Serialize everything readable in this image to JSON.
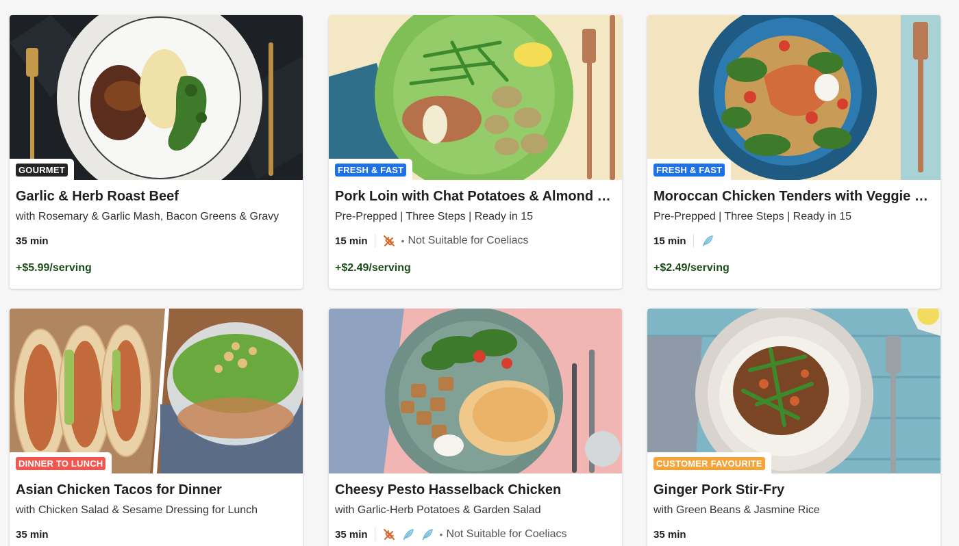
{
  "recipes": [
    {
      "tag": "GOURMET",
      "tag_color": "#242424",
      "title": "Garlic & Herb Roast Beef",
      "subtitle": "with Rosemary & Garlic Mash, Bacon Greens & Gravy",
      "time": "35 min",
      "note": "",
      "price": "+$5.99/serving"
    },
    {
      "tag": "FRESH & FAST",
      "tag_color": "#1e72e8",
      "title": "Pork Loin with Chat Potatoes & Almond Gre…",
      "subtitle": "Pre-Prepped | Three Steps | Ready in 15",
      "time": "15 min",
      "note": "Not Suitable for Coeliacs",
      "price": "+$2.49/serving"
    },
    {
      "tag": "FRESH & FAST",
      "tag_color": "#1e72e8",
      "title": "Moroccan Chicken Tenders with Veggie Cou…",
      "subtitle": "Pre-Prepped | Three Steps | Ready in 15",
      "time": "15 min",
      "note": "",
      "price": "+$2.49/serving"
    },
    {
      "tag": "DINNER TO LUNCH",
      "tag_color": "#f2564f",
      "title": "Asian Chicken Tacos for Dinner",
      "subtitle": "with Chicken Salad & Sesame Dressing for Lunch",
      "time": "35 min",
      "note": "",
      "price": ""
    },
    {
      "tag": "",
      "tag_color": "",
      "title": "Cheesy Pesto Hasselback Chicken",
      "subtitle": "with Garlic-Herb Potatoes & Garden Salad",
      "time": "35 min",
      "note": "Not Suitable for Coeliacs",
      "price": ""
    },
    {
      "tag": "CUSTOMER FAVOURITE",
      "tag_color": "#f6a33a",
      "title": "Ginger Pork Stir-Fry",
      "subtitle": "with Green Beans & Jasmine Rice",
      "time": "35 min",
      "note": "",
      "price": ""
    }
  ],
  "icons": {
    "gluten": "wheat-icon",
    "calorie": "feather-icon"
  },
  "colors": {
    "price": "#1d4d1a",
    "wheat_icon": "#d9682c",
    "feather_icon": "#6dbad6"
  }
}
